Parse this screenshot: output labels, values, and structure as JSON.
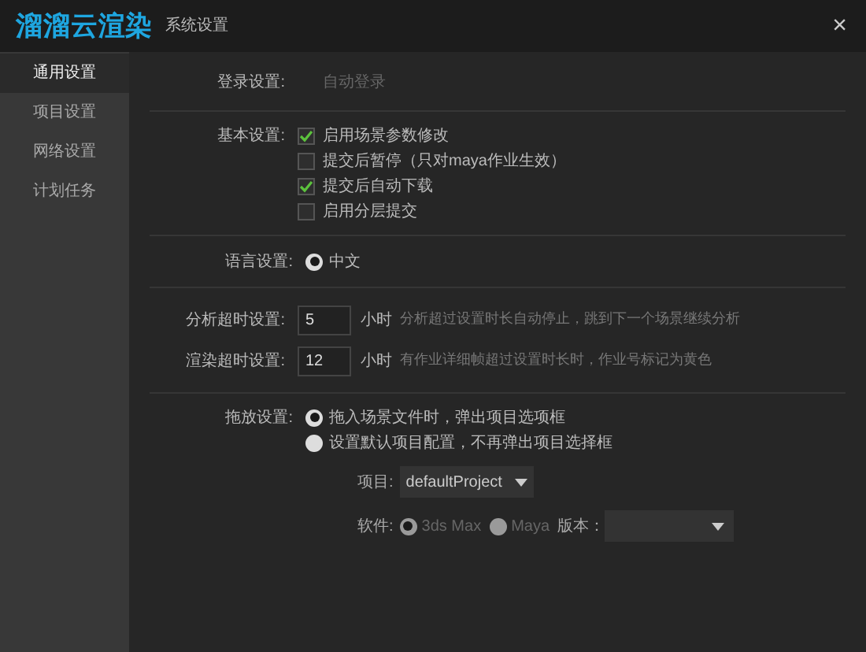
{
  "window": {
    "logo": "溜溜云渲染",
    "title": "系统设置",
    "close": "×"
  },
  "sidebar": {
    "items": [
      {
        "label": "通用设置",
        "selected": true
      },
      {
        "label": "项目设置",
        "selected": false
      },
      {
        "label": "网络设置",
        "selected": false
      },
      {
        "label": "计划任务",
        "selected": false
      }
    ]
  },
  "login": {
    "label": "登录设置:",
    "value": "自动登录"
  },
  "basic": {
    "label": "基本设置:",
    "options": [
      {
        "label": "启用场景参数修改",
        "checked": true
      },
      {
        "label": "提交后暂停（只对maya作业生效）",
        "checked": false
      },
      {
        "label": "提交后自动下载",
        "checked": true
      },
      {
        "label": "启用分层提交",
        "checked": false
      }
    ]
  },
  "language": {
    "label": "语言设置:",
    "options": [
      {
        "label": "中文",
        "selected": true
      }
    ]
  },
  "timeouts": [
    {
      "label": "分析超时设置:",
      "value": "5",
      "unit": "小时",
      "note": "分析超过设置时长自动停止，跳到下一个场景继续分析"
    },
    {
      "label": "渲染超时设置:",
      "value": "12",
      "unit": "小时",
      "note": "有作业详细帧超过设置时长时，作业号标记为黄色"
    }
  ],
  "drag": {
    "label": "拖放设置:",
    "options": [
      {
        "label": "拖入场景文件时，弹出项目选项框",
        "selected": true
      },
      {
        "label": "设置默认项目配置，不再弹出项目选择框",
        "selected": false
      }
    ],
    "project": {
      "label": "项目:",
      "value": "defaultProject"
    },
    "software": {
      "label": "软件:",
      "options": [
        {
          "label": "3ds Max",
          "selected": true
        },
        {
          "label": "Maya",
          "selected": false
        }
      ],
      "version_label": "版本："
    }
  }
}
